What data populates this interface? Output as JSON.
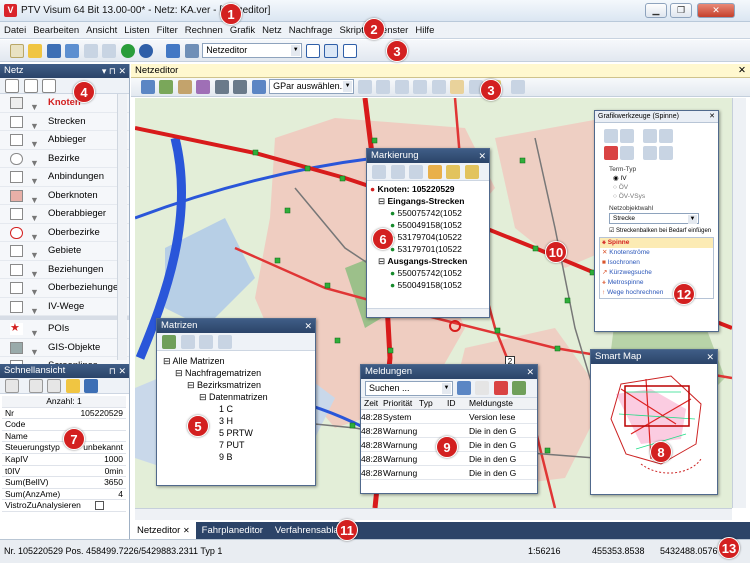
{
  "window": {
    "title": "PTV Visum 64 Bit 13.00-00* - Netz: KA.ver - [Netzeditor]",
    "app_icon": "V"
  },
  "menu": [
    "Datei",
    "Bearbeiten",
    "Ansicht",
    "Listen",
    "Filter",
    "Rechnen",
    "Grafik",
    "Netz",
    "Nachfrage",
    "Skripte",
    "Fenster",
    "Hilfe"
  ],
  "toolbar": {
    "combo_value": "Netzeditor"
  },
  "netz_panel": {
    "title": "Netz",
    "items": [
      "Knoten",
      "Strecken",
      "Abbieger",
      "Bezirke",
      "Anbindungen",
      "Oberknoten",
      "Oberabbieger",
      "Oberbezirke",
      "Gebiete",
      "Beziehungen",
      "Oberbeziehungen",
      "IV-Wege",
      "POIs",
      "GIS-Objekte",
      "Screenlines"
    ]
  },
  "schnellansicht": {
    "title": "Schnellansicht",
    "count_label": "Anzahl: 1",
    "rows": [
      {
        "k": "Nr",
        "v": "105220529"
      },
      {
        "k": "Code",
        "v": ""
      },
      {
        "k": "Name",
        "v": ""
      },
      {
        "k": "Steuerungstyp",
        "v": "unbekannt"
      },
      {
        "k": "KapIV",
        "v": "1000"
      },
      {
        "k": "t0IV",
        "v": "0min"
      },
      {
        "k": "Sum(BelIV)",
        "v": "3650"
      },
      {
        "k": "Sum(AnzAme)",
        "v": "4"
      },
      {
        "k": "VistroZuAnalysieren",
        "v": ""
      }
    ]
  },
  "editor": {
    "title": "Netzeditor",
    "gpar_combo": "GPar auswählen..."
  },
  "markierung": {
    "title": "Markierung",
    "root": "Knoten: 105220529",
    "group1": "Eingangs-Strecken",
    "items1": [
      "550075742(1052",
      "550049158(1052",
      "53179704(10522",
      "53179701(10522"
    ],
    "group2": "Ausgangs-Strecken",
    "items2": [
      "550075742(1052",
      "550049158(1052"
    ]
  },
  "matrizen": {
    "title": "Matrizen",
    "tree": [
      {
        "label": "Alle Matrizen",
        "level": 0
      },
      {
        "label": "Nachfragematrizen",
        "level": 1
      },
      {
        "label": "Bezirksmatrizen",
        "level": 2
      },
      {
        "label": "Datenmatrizen",
        "level": 3
      },
      {
        "label": "1 C",
        "level": 4
      },
      {
        "label": "3 H",
        "level": 4
      },
      {
        "label": "5 PRTW",
        "level": 4
      },
      {
        "label": "7 PUT",
        "level": 4
      },
      {
        "label": "9 B",
        "level": 4
      }
    ]
  },
  "meldungen": {
    "title": "Meldungen",
    "search": "Suchen ...",
    "columns": [
      "Zeit",
      "Priorität",
      "Typ",
      "ID",
      "Meldungste"
    ],
    "rows": [
      [
        "48:28",
        "System",
        "",
        "",
        "Version lese"
      ],
      [
        "48:28",
        "Warnung",
        "",
        "",
        "Die in den G"
      ],
      [
        "48:28",
        "Warnung",
        "",
        "",
        "Die in den G"
      ],
      [
        "48:28",
        "Warnung",
        "",
        "",
        "Die in den G"
      ],
      [
        "48:28",
        "Warnung",
        "",
        "",
        "Die in den G"
      ]
    ]
  },
  "spinne": {
    "title": "Grafikwerkzeuge (Spinne)",
    "termtyp_label": "Term-Typ",
    "radios": [
      "IV",
      "ÖV",
      "ÖV-VSys"
    ],
    "netzobjekt_label": "Netzobjektwahl",
    "netzobjekt_value": "Strecke",
    "checkbox": "Streckenbalken bei Bedarf einfügen",
    "list": [
      "Spinne",
      "Knotenströme",
      "Isochronen",
      "Kürzwegsuche",
      "Metrospinne",
      "Wege hochrechnen"
    ]
  },
  "smartmap": {
    "title": "Smart Map"
  },
  "tabs": [
    "Netzeditor",
    "Fahrplaneditor",
    "Verfahrensablauf"
  ],
  "status": {
    "left": "Nr. 105220529  Pos. 458499.7226/5429883.2311  Typ 1",
    "scale": "1:56216",
    "x": "455353.8538",
    "y": "5432488.0576"
  },
  "markers": [
    "1",
    "2",
    "3",
    "3",
    "4",
    "5",
    "6",
    "7",
    "8",
    "9",
    "10",
    "11",
    "12",
    "13"
  ],
  "map_label": "2",
  "colors": {
    "accent_red": "#d32020",
    "panel_header": "#2b4469",
    "editor_header": "#fff8cf"
  }
}
